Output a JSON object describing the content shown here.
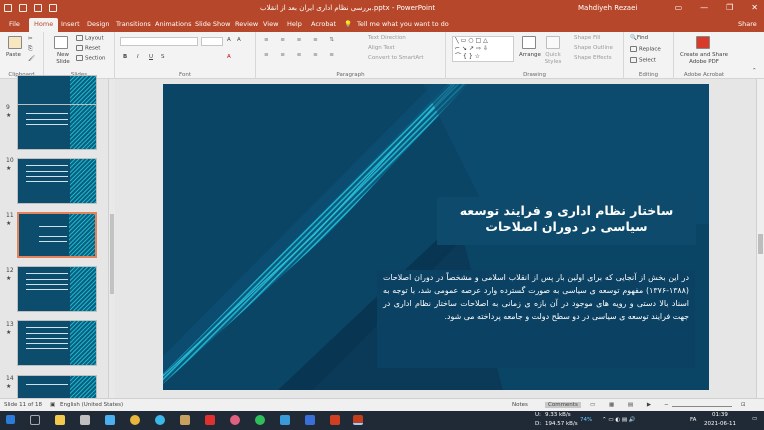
{
  "window": {
    "doc_title": "بررسی نظام اداری ایران بعد از انقلاب.pptx  -  PowerPoint",
    "user": "Mahdiyeh Rezaei"
  },
  "tabs": [
    "File",
    "Home",
    "Insert",
    "Design",
    "Transitions",
    "Animations",
    "Slide Show",
    "Review",
    "View",
    "Help",
    "Acrobat"
  ],
  "tell_me": "Tell me what you want to do",
  "share": "Share",
  "ribbon": {
    "clipboard": {
      "label": "Clipboard",
      "paste": "Paste"
    },
    "slides": {
      "label": "Slides",
      "new_slide": "New Slide",
      "layout": "Layout",
      "reset": "Reset",
      "section": "Section"
    },
    "font": {
      "label": "Font",
      "bold": "B",
      "italic": "I",
      "underline": "U",
      "strike": "S"
    },
    "paragraph": {
      "label": "Paragraph",
      "text_direction": "Text Direction",
      "align_text": "Align Text",
      "smartart": "Convert to SmartArt"
    },
    "drawing": {
      "label": "Drawing",
      "arrange": "Arrange",
      "quick_styles": "Quick Styles",
      "shape_fill": "Shape Fill",
      "shape_outline": "Shape Outline",
      "shape_effects": "Shape Effects"
    },
    "editing": {
      "label": "Editing",
      "find": "Find",
      "replace": "Replace",
      "select": "Select"
    },
    "acrobat": {
      "label": "Adobe Acrobat",
      "create": "Create and Share Adobe PDF"
    }
  },
  "thumbnails": [
    {
      "num": "9",
      "star": "★"
    },
    {
      "num": "10",
      "star": "★"
    },
    {
      "num": "11",
      "star": "★"
    },
    {
      "num": "12",
      "star": "★"
    },
    {
      "num": "13",
      "star": "★"
    },
    {
      "num": "14",
      "star": "★"
    }
  ],
  "slide": {
    "title": "ساختار نظام اداری و فرایند توسعه سیاسی در دوران اصلاحات",
    "body": "در این بخش از آنجایی که برای اولین بار پس از انقلاب اسلامی و مشخصاً در دوران اصلاحات (۱۳۸۸-۱۳۷۶) مفهوم توسعه ی سیاسی به صورت گسترده وارد عرصه عمومی شد، با توجه به اسناد بالا دستی و رویه های موجود در آن بازه ی زمانی به اصلاحات ساختار نظام اداری در جهت فرایند توسعه ی سیاسی در دو سطح دولت و جامعه پرداخته می شود."
  },
  "status": {
    "slide_info": "Slide 11 of 18",
    "language": "English (United States)",
    "notes": "Notes",
    "comments": "Comments",
    "zoom": "−"
  },
  "taskbar": {
    "net_up": "9.33 kB/s",
    "net_down": "194.57 kB/s",
    "cpu": "74%",
    "lang": "FA",
    "time": "01:39",
    "date": "2021-06-11",
    "u": "U:",
    "d": "D:"
  },
  "colors": {
    "accent": "#b7472a",
    "slide_bg": "#0a4566",
    "stripe": "#19b5c9"
  }
}
